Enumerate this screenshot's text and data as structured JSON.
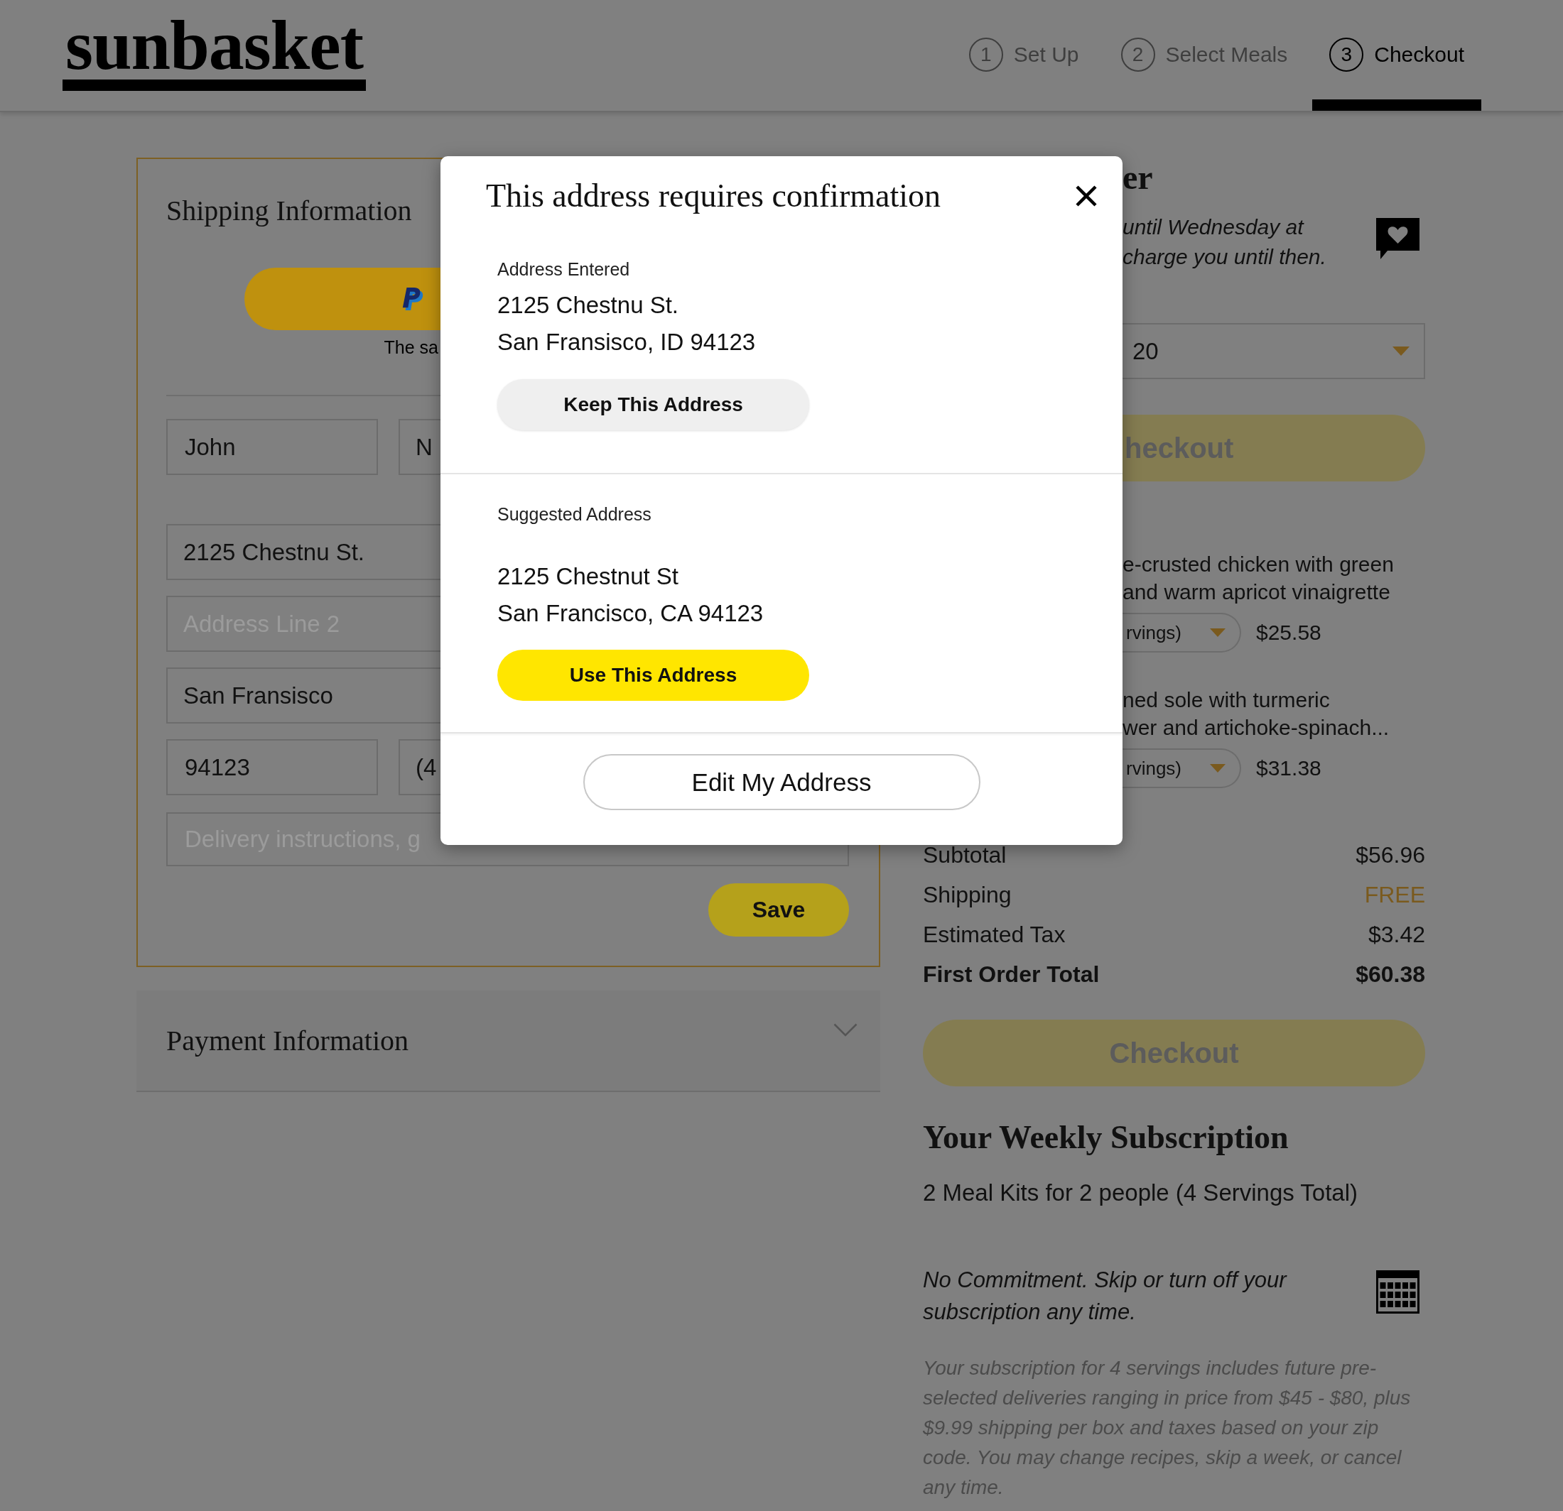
{
  "header": {
    "logo": "sunbasket",
    "steps": [
      {
        "number": "1",
        "label": "Set Up",
        "selected": false
      },
      {
        "number": "2",
        "label": "Select Meals",
        "selected": false
      },
      {
        "number": "3",
        "label": "Checkout",
        "selected": true
      }
    ]
  },
  "shipping": {
    "title": "Shipping Information",
    "paypal_note": "The sa",
    "address_fields": [
      [
        {
          "value": "John"
        },
        {
          "value": "N"
        }
      ],
      [
        {
          "value": "2125 Chestnu St."
        }
      ],
      [
        {
          "placeholder": "Address Line 2"
        }
      ],
      [
        {
          "value": "San Fransisco"
        }
      ],
      [
        {
          "value": "94123"
        },
        {
          "value": "(4"
        }
      ]
    ],
    "instructions_field": {
      "placeholder": "Delivery instructions, g"
    },
    "save_button": "Save"
  },
  "payment": {
    "title": "Payment Information",
    "expanded": false
  },
  "order": {
    "heading": "er",
    "notice_lines": [
      "until Wednesday at",
      "charge you until then."
    ],
    "delivery_select": "20",
    "checkout_top": {
      "label": "heckout",
      "disabled": true
    },
    "meals": [
      {
        "lines": [
          "e-crusted chicken with green",
          "and warm apricot vinaigrette"
        ],
        "servings": "rvings)",
        "price": "$25.58"
      },
      {
        "lines": [
          "ned sole with turmeric",
          "wer and artichoke-spinach..."
        ],
        "servings": "rvings)",
        "price": "$31.38"
      }
    ],
    "totals": [
      {
        "label": "Subtotal",
        "value": "$56.96",
        "kind": "normal"
      },
      {
        "label": "Shipping",
        "value": "FREE",
        "kind": "free"
      },
      {
        "label": "Estimated Tax",
        "value": "$3.42",
        "kind": "normal"
      },
      {
        "label": "First Order Total",
        "value": "$60.38",
        "kind": "total"
      }
    ],
    "checkout_bottom": {
      "label": "Checkout",
      "disabled": true
    }
  },
  "subscription": {
    "title": "Your Weekly Subscription",
    "plan": "2 Meal Kits for 2 people (4 Servings Total)",
    "commitment": "No Commitment. Skip or turn off your subscription any time.",
    "details": "Your subscription for 4 servings includes future pre-selected deliveries ranging in price from $45 - $80, plus $9.99 shipping per box and taxes based on your zip code. You may change recipes, skip a week, or cancel any time."
  },
  "dialog": {
    "title": "This address requires confirmation",
    "sections": [
      {
        "label": "Address Entered",
        "lines": [
          "2125 Chestnu St.",
          "San Fransisco, ID 94123"
        ],
        "button": {
          "label": "Keep This Address",
          "kind": "secondary"
        }
      },
      {
        "label": "Suggested Address",
        "lines": [
          "2125 Chestnut St",
          "San Francisco, CA 94123"
        ],
        "button": {
          "label": "Use This Address",
          "kind": "primary"
        }
      }
    ],
    "edit_button": "Edit My Address"
  }
}
